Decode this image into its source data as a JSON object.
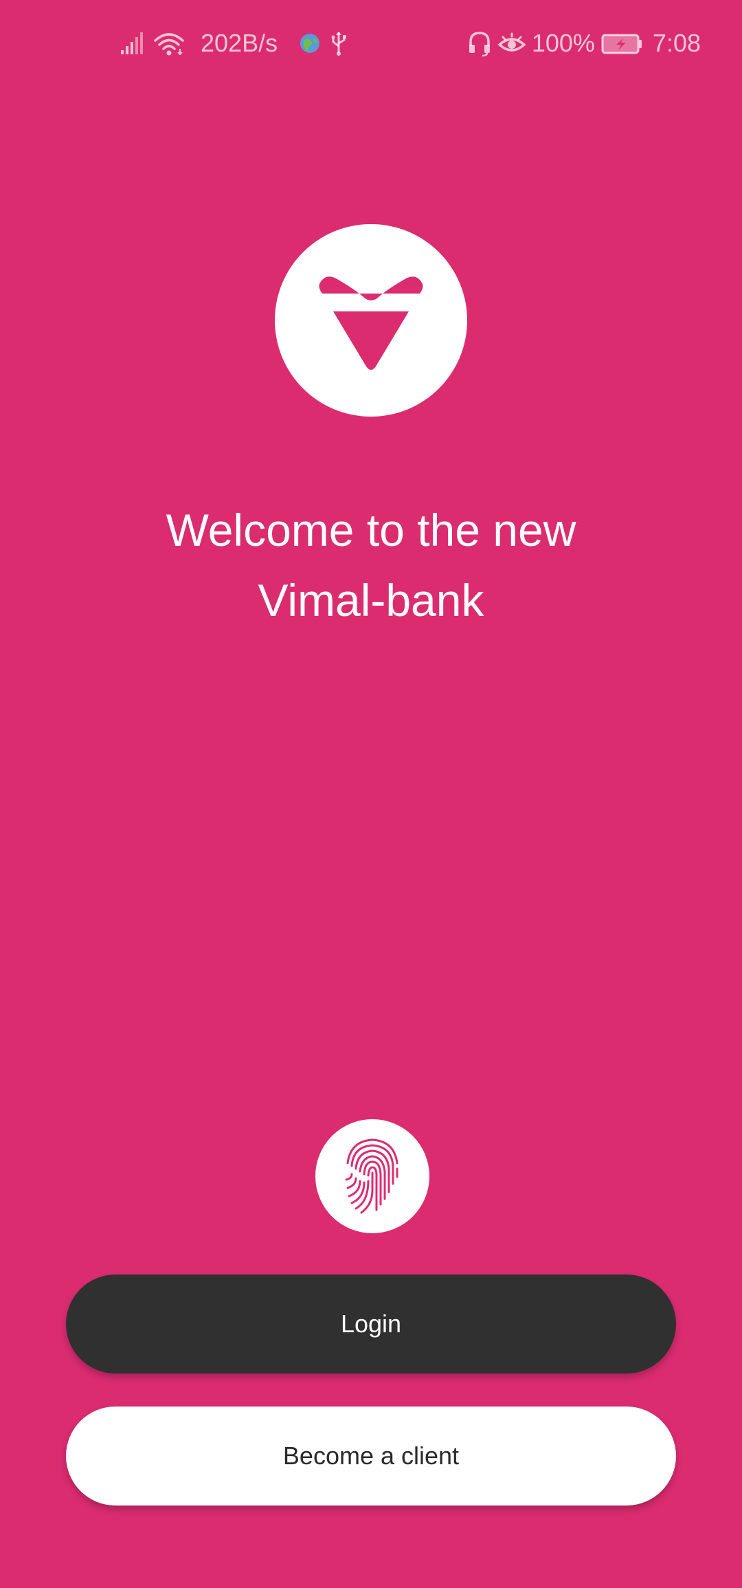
{
  "status_bar": {
    "network_speed": "202B/s",
    "battery_percent": "100%",
    "time": "7:08",
    "icons": [
      "signal-icon",
      "wifi-icon",
      "globe-icon",
      "usb-icon",
      "headset-icon",
      "eye-icon",
      "battery-charging-icon"
    ]
  },
  "app": {
    "logo_icon": "vimal-bank-logo-icon",
    "welcome_line1": "Welcome to the new",
    "welcome_line2": "Vimal-bank"
  },
  "actions": {
    "fingerprint_icon": "fingerprint-icon",
    "login_label": "Login",
    "become_client_label": "Become a client"
  },
  "colors": {
    "background": "#DB2C70",
    "login_button": "#303030",
    "client_button": "#FFFFFF",
    "accent": "#DB2C70"
  }
}
